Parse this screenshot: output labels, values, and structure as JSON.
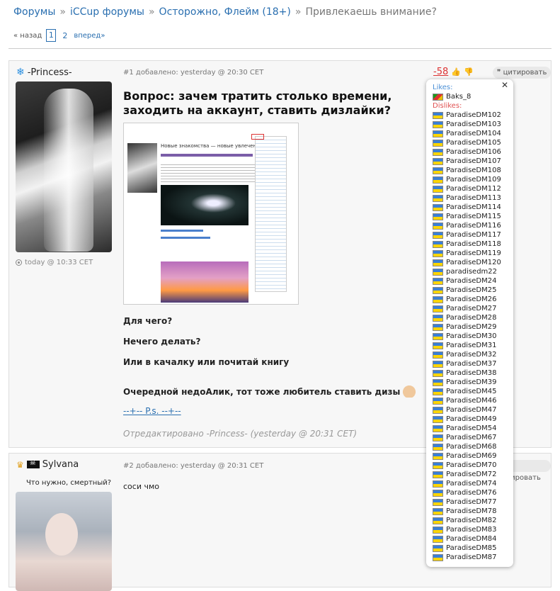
{
  "breadcrumbs": {
    "items": [
      "Форумы",
      "iCCup форумы",
      "Осторожно, Флейм (18+)"
    ],
    "current": "Привлекаешь внимание?",
    "sep": "»"
  },
  "pager": {
    "prev": "« назад",
    "current": "1",
    "page2": "2",
    "next": "вперед»"
  },
  "post1": {
    "author": "-Princess-",
    "author_icon": "snowflake-icon",
    "online": "today @ 10:33 CET",
    "meta": "#1 добавлено: yesterday @ 20:30 CET",
    "score": "-58",
    "quote": "цитировать",
    "title": "Вопрос: зачем тратить столько времени, заходить на аккаунт, ставить дизлайки?",
    "screenshot": {
      "title": "Новые знакомства — новые увлечения"
    },
    "lines": [
      "Для чего?",
      "Нечего делать?",
      "Или в качалку или почитай книгу",
      "Очередной недоАлик, тот тоже любитель ставить дизы"
    ],
    "ps": "--+-- P.s. --+--",
    "edited": "Отредактировано -Princess- (yesterday @ 20:31 CET)"
  },
  "post2": {
    "author": "Sylvana",
    "status": "Что нужно, смертный?",
    "meta": "#2 добавлено: yesterday @ 20:31 CET",
    "text": "соси чмо",
    "quote": "цитировать"
  },
  "popup": {
    "likes_label": "Likes:",
    "dislikes_label": "Dislikes:",
    "likes": [
      "Baks_8"
    ],
    "dislikes": [
      "ParadiseDM102",
      "ParadiseDM103",
      "ParadiseDM104",
      "ParadiseDM105",
      "ParadiseDM106",
      "ParadiseDM107",
      "ParadiseDM108",
      "ParadiseDM109",
      "ParadiseDM112",
      "ParadiseDM113",
      "ParadiseDM114",
      "ParadiseDM115",
      "ParadiseDM116",
      "ParadiseDM117",
      "ParadiseDM118",
      "ParadiseDM119",
      "ParadiseDM120",
      "paradisedm22",
      "ParadiseDM24",
      "ParadiseDM25",
      "ParadiseDM26",
      "ParadiseDM27",
      "ParadiseDM28",
      "ParadiseDM29",
      "ParadiseDM30",
      "ParadiseDM31",
      "ParadiseDM32",
      "ParadiseDM37",
      "ParadiseDM38",
      "ParadiseDM39",
      "ParadiseDM45",
      "ParadiseDM46",
      "ParadiseDM47",
      "ParadiseDM49",
      "ParadiseDM54",
      "ParadiseDM67",
      "ParadiseDM68",
      "ParadiseDM69",
      "ParadiseDM70",
      "ParadiseDM72",
      "ParadiseDM74",
      "ParadiseDM76",
      "ParadiseDM77",
      "ParadiseDM78",
      "ParadiseDM82",
      "ParadiseDM83",
      "ParadiseDM84",
      "ParadiseDM85",
      "ParadiseDM87"
    ]
  }
}
